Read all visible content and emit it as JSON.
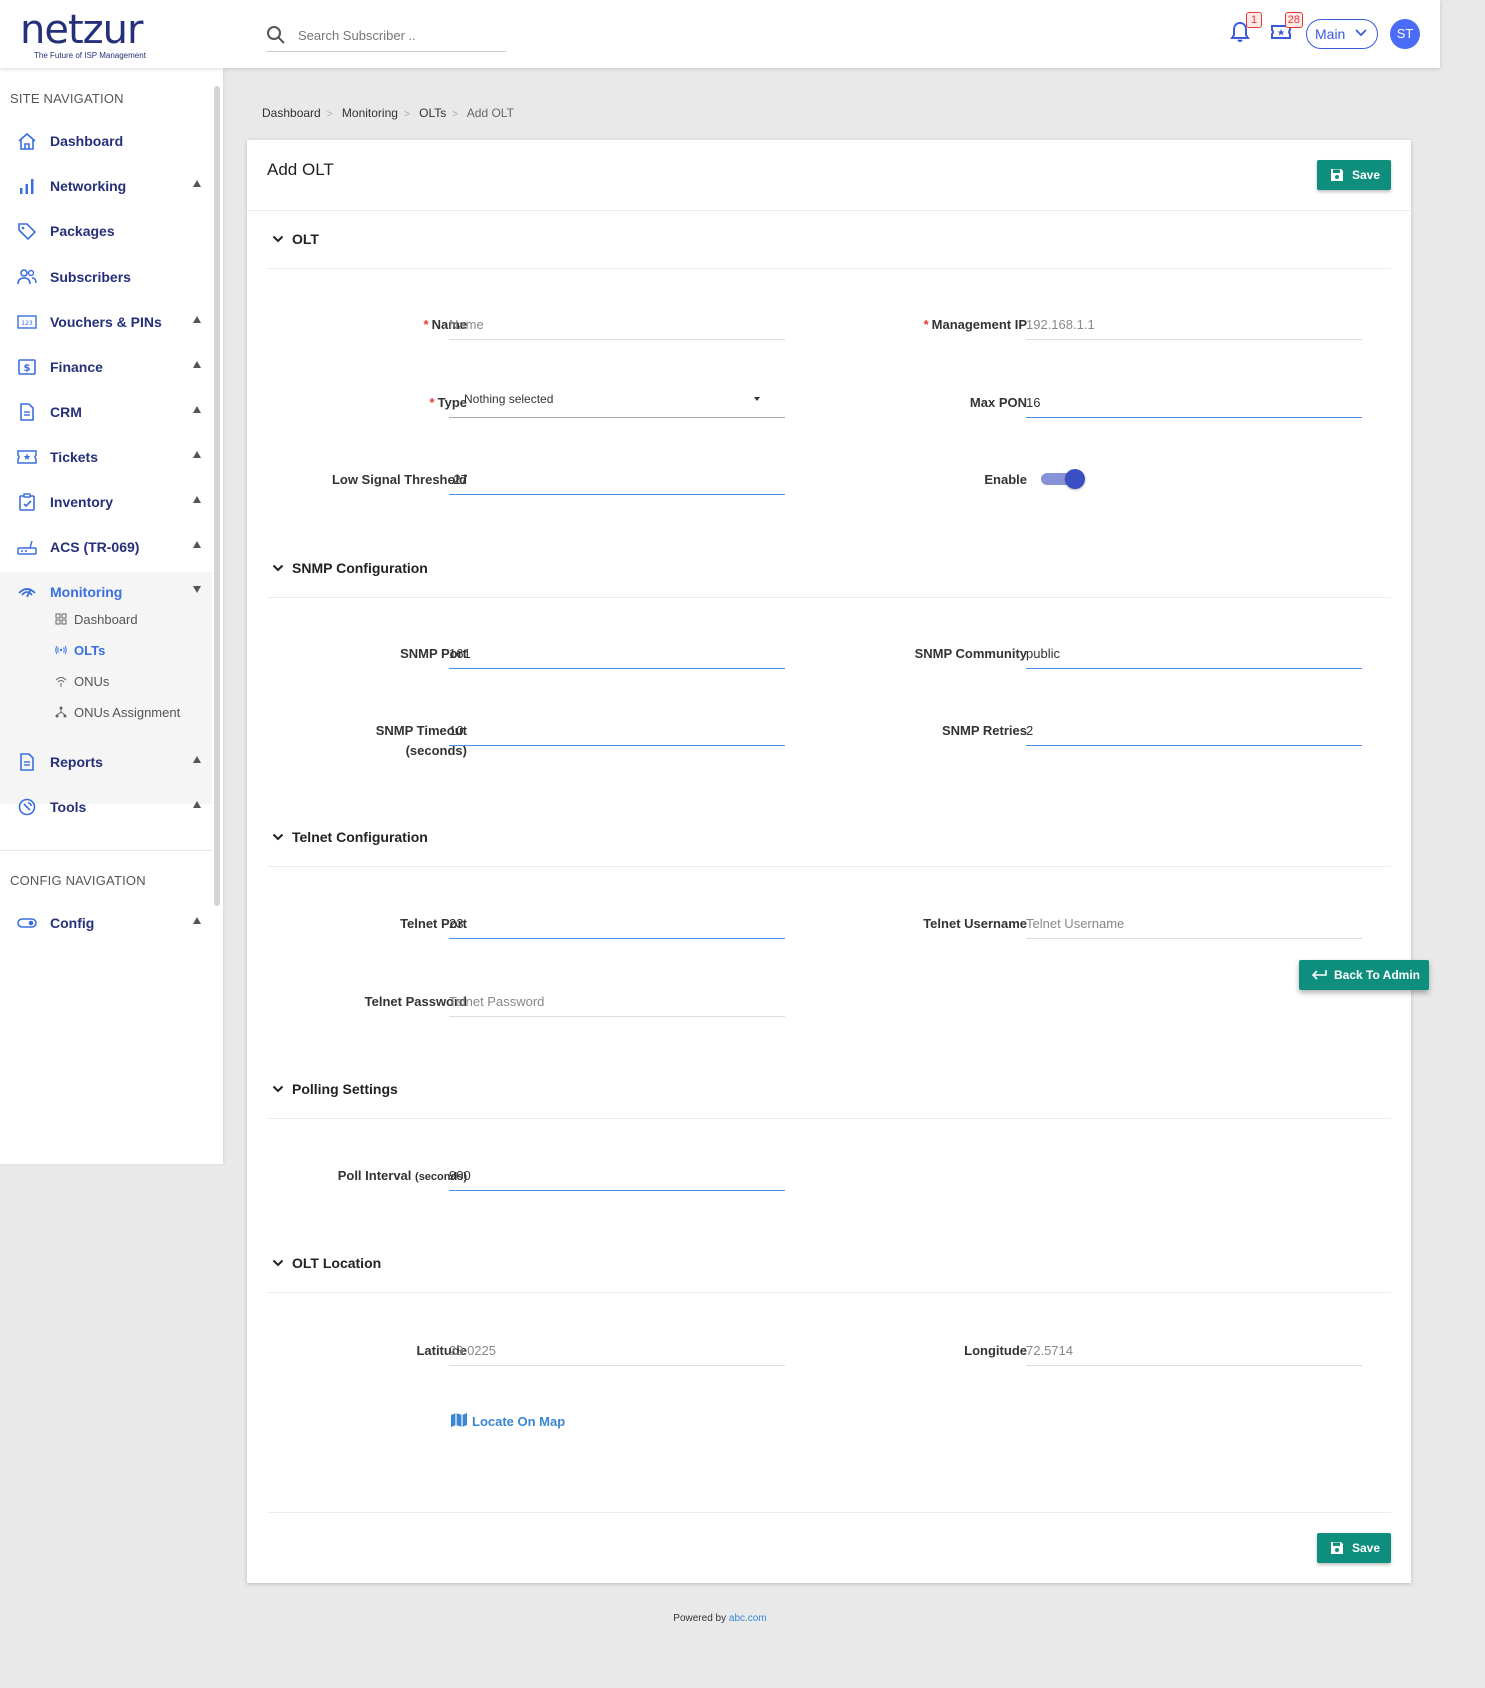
{
  "header": {
    "logo_text": "netzur",
    "logo_tagline": "The Future of ISP Management",
    "search_placeholder": "Search Subscriber ..",
    "notification_count": "1",
    "ticket_count": "28",
    "branch_label": "Main",
    "avatar_initials": "ST"
  },
  "sidebar": {
    "site_nav_heading": "SITE NAVIGATION",
    "items": [
      {
        "label": "Dashboard",
        "icon": "home-icon"
      },
      {
        "label": "Networking",
        "icon": "bar-chart-icon"
      },
      {
        "label": "Packages",
        "icon": "tag-icon"
      },
      {
        "label": "Subscribers",
        "icon": "users-icon"
      },
      {
        "label": "Vouchers & PINs",
        "icon": "voucher-icon"
      },
      {
        "label": "Finance",
        "icon": "dollar-icon"
      },
      {
        "label": "CRM",
        "icon": "document-icon"
      },
      {
        "label": "Tickets",
        "icon": "ticket-icon"
      },
      {
        "label": "Inventory",
        "icon": "clipboard-icon"
      },
      {
        "label": "ACS (TR-069)",
        "icon": "router-icon"
      },
      {
        "label": "Monitoring",
        "icon": "monitoring-icon"
      },
      {
        "label": "Reports",
        "icon": "report-icon"
      },
      {
        "label": "Tools",
        "icon": "tools-icon"
      }
    ],
    "monitoring_sub": [
      {
        "label": "Dashboard",
        "icon": "grid-icon"
      },
      {
        "label": "OLTs",
        "icon": "antenna-icon"
      },
      {
        "label": "ONUs",
        "icon": "wifi-icon"
      },
      {
        "label": "ONUs Assignment",
        "icon": "network-icon"
      }
    ],
    "config_nav_heading": "CONFIG NAVIGATION",
    "config_item": {
      "label": "Config",
      "icon": "toggle-icon"
    }
  },
  "breadcrumb": [
    "Dashboard",
    "Monitoring",
    "OLTs",
    "Add OLT"
  ],
  "page": {
    "title": "Add OLT",
    "save_label": "Save",
    "back_label": "Back To Admin"
  },
  "sections": {
    "olt": {
      "heading": "OLT",
      "name_label": "Name",
      "name_placeholder": "Name",
      "mgmt_ip_label": "Management IP",
      "mgmt_ip_placeholder": "192.168.1.1",
      "type_label": "Type",
      "type_value": "Nothing selected",
      "max_pon_label": "Max PON",
      "max_pon_value": "16",
      "low_signal_label": "Low Signal Threshold",
      "low_signal_value": "-27",
      "enable_label": "Enable"
    },
    "snmp": {
      "heading": "SNMP Configuration",
      "port_label": "SNMP Port",
      "port_value": "161",
      "community_label": "SNMP Community",
      "community_value": "public",
      "timeout_label": "SNMP Timeout",
      "timeout_label_sub": "(seconds)",
      "timeout_value": "10",
      "retries_label": "SNMP Retries",
      "retries_value": "2"
    },
    "telnet": {
      "heading": "Telnet Configuration",
      "port_label": "Telnet Port",
      "port_value": "23",
      "username_label": "Telnet Username",
      "username_placeholder": "Telnet Username",
      "password_label": "Telnet Password",
      "password_placeholder": "Telnet Password"
    },
    "polling": {
      "heading": "Polling Settings",
      "interval_label": "Poll Interval",
      "interval_label_sub": "(seconds)",
      "interval_value": "900"
    },
    "location": {
      "heading": "OLT Location",
      "lat_label": "Latitude",
      "lat_placeholder": "23.0225",
      "lng_label": "Longitude",
      "lng_placeholder": "72.5714",
      "map_link": "Locate On Map"
    }
  },
  "footer": {
    "prefix": "Powered by",
    "link": "abc.com"
  },
  "colors": {
    "brand": "#26307a",
    "accent": "#3b6fe0",
    "save_button": "#0e8f7e",
    "required": "#e53935"
  }
}
